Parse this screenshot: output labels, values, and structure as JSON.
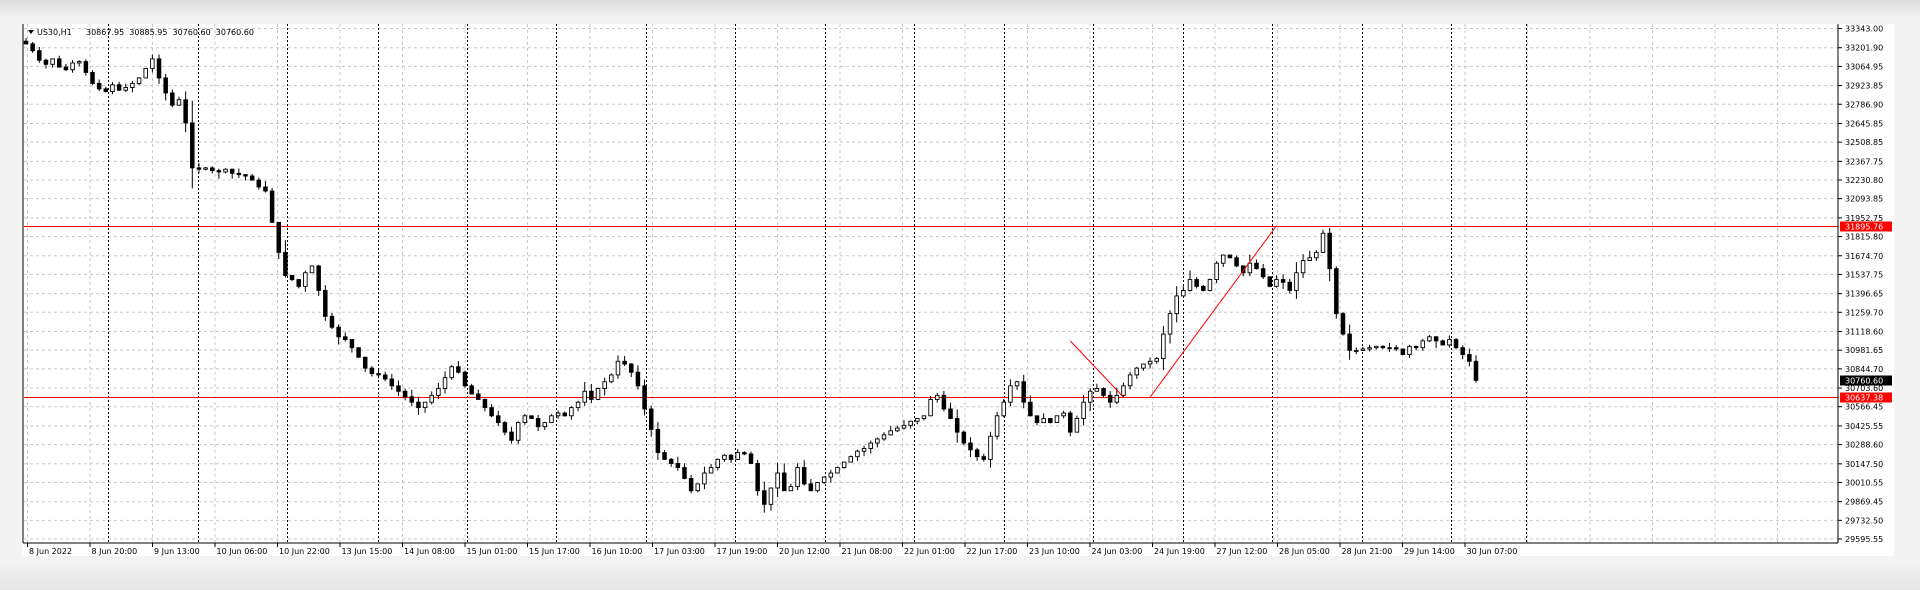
{
  "window": {
    "symbol": "US30,H1",
    "ohlc": "30867.95  30885.95  30760.60  30760.60"
  },
  "colors": {
    "candles": "#000000",
    "lines": "#ff0000",
    "grid": "#c8c8c8",
    "background": "#ffffff",
    "current_price_tag": "#000000",
    "level_tag": "#ff0000"
  },
  "chart_data": {
    "type": "candlestick",
    "title": "",
    "symbol": "US30",
    "timeframe": "H1",
    "grid": true,
    "yticks": [
      "33343.00",
      "33201.90",
      "33064.95",
      "32923.85",
      "32786.90",
      "32645.85",
      "32508.85",
      "32367.75",
      "32230.80",
      "32093.85",
      "31952.75",
      "31815.80",
      "31674.70",
      "31537.75",
      "31396.65",
      "31259.70",
      "31118.60",
      "30981.65",
      "30844.70",
      "30703.60",
      "30566.45",
      "30425.55",
      "30288.60",
      "30147.50",
      "30010.55",
      "29869.45",
      "29732.50",
      "29595.55"
    ],
    "ylim": [
      29595.55,
      33343.0
    ],
    "xticks": [
      "8 Jun 2022",
      "8 Jun 20:00",
      "9 Jun 13:00",
      "10 Jun 06:00",
      "10 Jun 22:00",
      "13 Jun 15:00",
      "14 Jun 08:00",
      "15 Jun 01:00",
      "15 Jun 17:00",
      "16 Jun 10:00",
      "17 Jun 03:00",
      "17 Jun 19:00",
      "20 Jun 12:00",
      "21 Jun 08:00",
      "22 Jun 01:00",
      "22 Jun 17:00",
      "23 Jun 10:00",
      "24 Jun 03:00",
      "24 Jun 19:00",
      "27 Jun 12:00",
      "28 Jun 05:00",
      "28 Jun 21:00",
      "29 Jun 14:00",
      "30 Jun 07:00"
    ],
    "horizontal_levels": [
      {
        "price": 31895.76,
        "label": "31895.76"
      },
      {
        "price": 30637.38,
        "label": "30637.38"
      }
    ],
    "current_price": {
      "price": 30760.6,
      "label": "30760.60"
    },
    "drawn_lines": [
      {
        "from_bar": 157,
        "from_price": 31050,
        "to_bar": 165,
        "to_price": 30637
      },
      {
        "from_bar": 169,
        "from_price": 30637,
        "to_bar": 188,
        "to_price": 31895
      }
    ],
    "close_series": [
      33230,
      33180,
      33110,
      33080,
      33120,
      33060,
      33040,
      33090,
      33100,
      33020,
      32940,
      32900,
      32880,
      32930,
      32890,
      32910,
      32940,
      32980,
      33050,
      33120,
      32980,
      32870,
      32780,
      32820,
      32650,
      32320,
      32310,
      32320,
      32300,
      32290,
      32310,
      32280,
      32270,
      32260,
      32230,
      32180,
      32150,
      31920,
      31700,
      31530,
      31500,
      31450,
      31550,
      31600,
      31420,
      31230,
      31150,
      31080,
      31060,
      31000,
      30930,
      30850,
      30810,
      30800,
      30770,
      30720,
      30680,
      30640,
      30600,
      30560,
      30600,
      30650,
      30700,
      30780,
      30860,
      30820,
      30720,
      30660,
      30620,
      30560,
      30500,
      30450,
      30380,
      30320,
      30450,
      30500,
      30480,
      30420,
      30450,
      30500,
      30520,
      30500,
      30560,
      30600,
      30680,
      30620,
      30700,
      30750,
      30800,
      30900,
      30880,
      30820,
      30720,
      30550,
      30400,
      30230,
      30180,
      30150,
      30120,
      30040,
      29950,
      30000,
      30080,
      30120,
      30180,
      30210,
      30180,
      30230,
      30220,
      30150,
      29950,
      29850,
      29970,
      30080,
      29950,
      29980,
      30120,
      30000,
      29950,
      30010,
      30050,
      30080,
      30120,
      30160,
      30200,
      30240,
      30260,
      30300,
      30330,
      30360,
      30390,
      30410,
      30430,
      30460,
      30480,
      30500,
      30620,
      30650,
      30550,
      30480,
      30380,
      30300,
      30250,
      30200,
      30180,
      30350,
      30500,
      30600,
      30720,
      30750,
      30600,
      30500,
      30450,
      30480,
      30450,
      30500,
      30520,
      30380,
      30480,
      30600,
      30680,
      30700,
      30650,
      30600,
      30650,
      30720,
      30800,
      30850,
      30880,
      30900,
      30920,
      31100,
      31250,
      31380,
      31420,
      31500,
      31450,
      31420,
      31500,
      31620,
      31680,
      31660,
      31600,
      31550,
      31620,
      31580,
      31520,
      31450,
      31500,
      31480,
      31420,
      31550,
      31640,
      31660,
      31700,
      31840,
      31580,
      31250,
      31100,
      30980,
      30980,
      30990,
      31000,
      31010,
      31000,
      31000,
      30990,
      30950,
      31010,
      31000,
      31050,
      31080,
      31050,
      31020,
      31060,
      31000,
      30950,
      30900,
      30760
    ]
  }
}
